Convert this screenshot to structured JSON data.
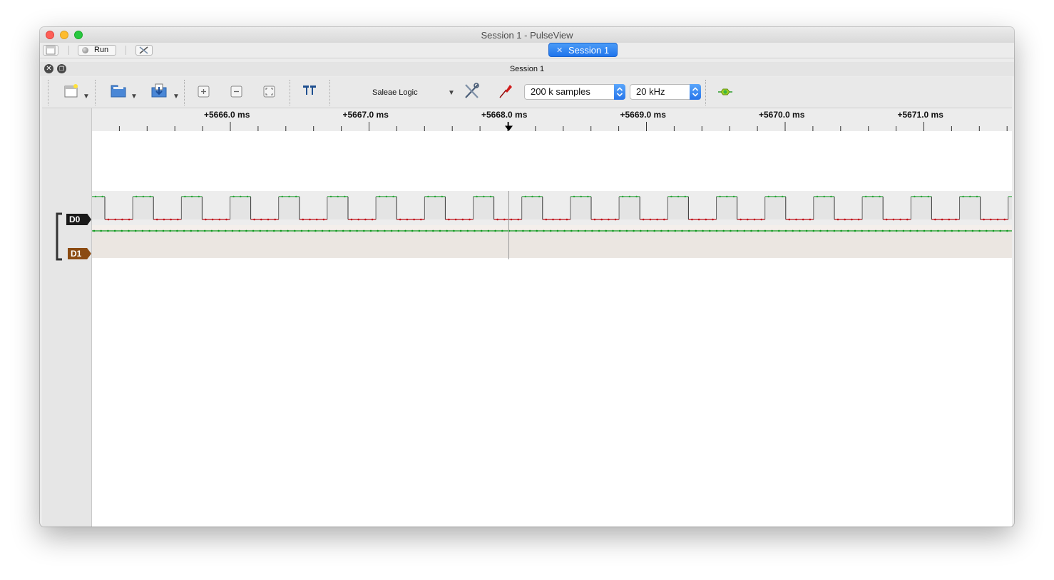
{
  "window": {
    "title": "Session 1 - PulseView"
  },
  "tabbar": {
    "run_label": "Run",
    "session_tab": "Session 1"
  },
  "dock": {
    "title": "Session 1"
  },
  "toolbar": {
    "device": "Saleae Logic",
    "samples": "200 k samples",
    "samplerate": "20 kHz"
  },
  "ruler": {
    "labels": [
      "+5666.0 ms",
      "+5667.0 ms",
      "+5668.0 ms",
      "+5669.0 ms",
      "+5670.0 ms",
      "+5671.0 ms"
    ]
  },
  "channels": [
    {
      "name": "D0",
      "color": "#1a1a1a"
    },
    {
      "name": "D1",
      "color": "#8b4513"
    }
  ],
  "colors": {
    "high": "#0c9a1e",
    "low": "#c0101a",
    "accent": "#1f74ec"
  },
  "icons": {
    "new_view": "new-view-icon",
    "open": "open-icon",
    "save": "save-icon",
    "zoom_in": "zoom-in-icon",
    "zoom_out": "zoom-out-icon",
    "zoom_fit": "zoom-fit-icon",
    "cursors": "cursor-icon",
    "config": "config-icon",
    "probe": "probe-icon",
    "decoder": "decoder-icon"
  }
}
